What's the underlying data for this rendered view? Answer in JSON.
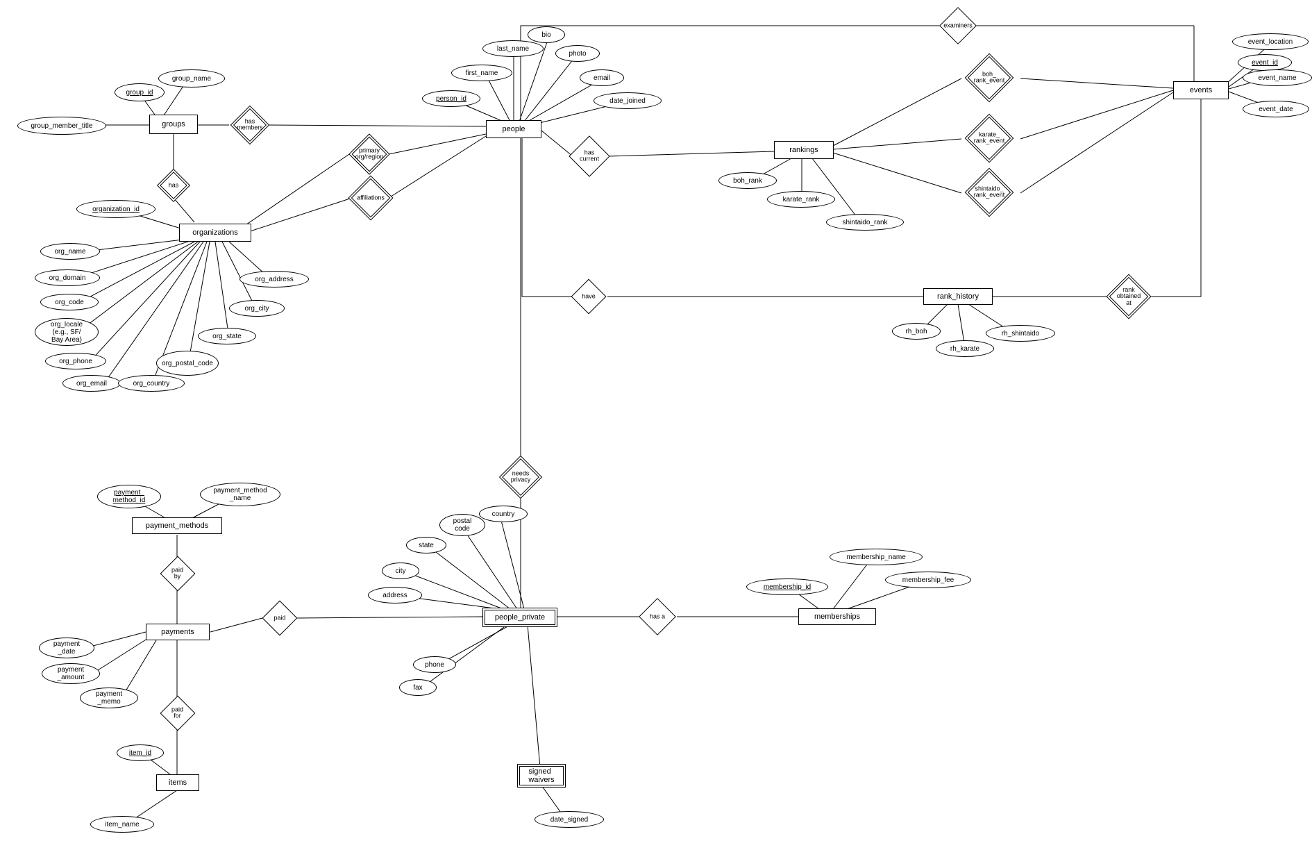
{
  "entities": {
    "groups": "groups",
    "organizations": "organizations",
    "people": "people",
    "rankings": "rankings",
    "rank_history": "rank_history",
    "events": "events",
    "payment_methods": "payment_methods",
    "payments": "payments",
    "items": "items",
    "people_private": "people_private",
    "signed_waivers": "signed\nwaivers",
    "memberships": "memberships"
  },
  "relationships": {
    "has_members": "has\nmembers",
    "has_groups_org": "has",
    "primary_org_region": "primary\norg/region",
    "affiliations": "affiliations",
    "has_current": "has\ncurrent",
    "examiners": "examiners",
    "boh_rank_event": "boh_\nrank_event",
    "karate_rank_event": "karate_\nrank_event",
    "shintaido_rank_event": "shintaido_\nrank_event",
    "have": "have",
    "rank_obtained_at": "rank\nobtained\nat",
    "needs_privacy": "needs\nprivacy",
    "paid": "paid",
    "paid_by": "paid by",
    "paid_for": "paid for",
    "has_a": "has a"
  },
  "attributes": {
    "group_id": "group_id",
    "group_name": "group_name",
    "group_member_title": "group_member_title",
    "organization_id": "organization_id",
    "org_name": "org_name",
    "org_domain": "org_domain",
    "org_code": "org_code",
    "org_locale": "org_locale\n(e.g., SF/\nBay Area)",
    "org_phone": "org_phone",
    "org_email": "org_email",
    "org_country": "org_country",
    "org_postal_code": "org_postal_code",
    "org_state": "org_state",
    "org_city": "org_city",
    "org_address": "org_address",
    "person_id": "person_id",
    "first_name": "first_name",
    "last_name": "last_name",
    "bio": "bio",
    "photo": "photo",
    "email": "email",
    "date_joined": "date_joined",
    "boh_rank": "boh_rank",
    "karate_rank": "karate_rank",
    "shintaido_rank": "shintaido_rank",
    "rh_boh": "rh_boh",
    "rh_karate": "rh_karate",
    "rh_shintaido": "rh_shintaido",
    "event_id": "event_id",
    "event_name": "event_name",
    "event_date": "event_date",
    "event_location": "event_location",
    "payment_method_id": "payment_\nmethod_id",
    "payment_method_name": "payment_method\n_name",
    "payment_date": "payment\n_date",
    "payment_amount": "payment\n_amount",
    "payment_memo": "payment\n_memo",
    "item_id": "item_id",
    "item_name": "item_name",
    "address": "address",
    "city": "city",
    "state": "state",
    "postal_code": "postal\ncode",
    "country": "country",
    "phone": "phone",
    "fax": "fax",
    "date_signed": "date_signed",
    "membership_id": "membership_id",
    "membership_name": "membership_name",
    "membership_fee": "membership_fee"
  }
}
